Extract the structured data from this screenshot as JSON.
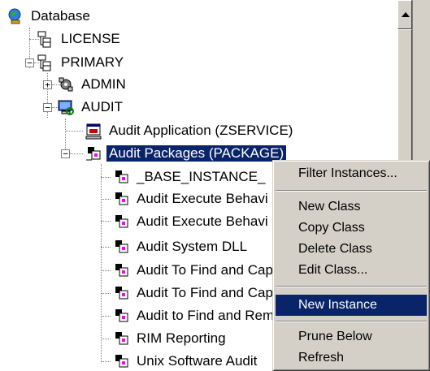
{
  "tree": {
    "root": {
      "label": "Database",
      "icon": "database-globe-icon"
    },
    "items": [
      {
        "label": "LICENSE",
        "icon": "tree-node-icon"
      },
      {
        "label": "PRIMARY",
        "icon": "tree-node-icon",
        "expander": "−"
      },
      {
        "label": "ADMIN",
        "icon": "admin-tools-icon",
        "expander": "+"
      },
      {
        "label": "AUDIT",
        "icon": "audit-monitor-icon",
        "expander": "−"
      },
      {
        "label": "Audit Application (ZSERVICE)",
        "icon": "application-icon"
      },
      {
        "label": "Audit Packages (PACKAGE)",
        "icon": "package-icon",
        "expander": "−",
        "selected": true
      },
      {
        "label": "_BASE_INSTANCE_",
        "icon": "package-instance-icon"
      },
      {
        "label": "Audit Execute Behavi",
        "icon": "package-instance-icon"
      },
      {
        "label": "Audit Execute Behavi",
        "icon": "package-instance-icon"
      },
      {
        "label": "Audit System DLL",
        "icon": "package-instance-icon"
      },
      {
        "label": "Audit To Find and Cap",
        "icon": "package-instance-icon"
      },
      {
        "label": "Audit To Find and Cap",
        "icon": "package-instance-icon"
      },
      {
        "label": "Audit to Find and Rem",
        "icon": "package-instance-icon"
      },
      {
        "label": "RIM Reporting",
        "icon": "package-instance-icon"
      },
      {
        "label": "Unix Software Audit",
        "icon": "package-instance-icon"
      }
    ]
  },
  "context_menu": {
    "items": [
      {
        "label": "Filter Instances...",
        "highlighted": false
      },
      {
        "label": "New Class",
        "highlighted": false
      },
      {
        "label": "Copy Class",
        "highlighted": false
      },
      {
        "label": "Delete Class",
        "highlighted": false
      },
      {
        "label": "Edit Class...",
        "highlighted": false
      },
      {
        "label": "New Instance",
        "highlighted": true
      },
      {
        "label": "Prune Below",
        "highlighted": false
      },
      {
        "label": "Refresh",
        "highlighted": false
      }
    ]
  },
  "colors": {
    "selection": "#0a246a",
    "menu_bg": "#d4d0c8"
  }
}
